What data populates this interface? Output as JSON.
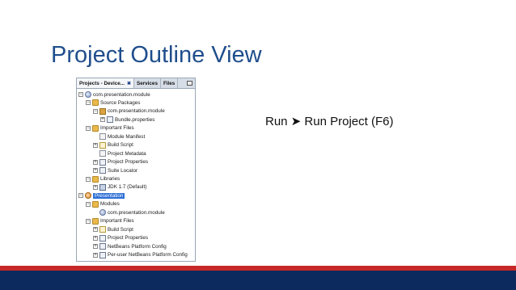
{
  "slide": {
    "title": "Project Outline View",
    "instruction": "Run ➤ Run Project (F6)"
  },
  "panel": {
    "tabs": [
      {
        "label": "Projects - Device..."
      },
      {
        "label": "Services"
      },
      {
        "label": "Files"
      }
    ],
    "tree": [
      {
        "label": "com.presentation.module",
        "icon": "module-icon",
        "toggle": "-",
        "selected": false
      },
      {
        "label": "Source Packages",
        "icon": "folder-icon",
        "toggle": "-",
        "selected": false
      },
      {
        "label": "com.presentation.module",
        "icon": "package-icon",
        "toggle": "-",
        "selected": false
      },
      {
        "label": "Bundle.properties",
        "icon": "properties-file-icon",
        "toggle": "+",
        "selected": false
      },
      {
        "label": "Important Files",
        "icon": "folder-icon",
        "toggle": "-",
        "selected": false
      },
      {
        "label": "Module Manifest",
        "icon": "file-icon",
        "toggle": "",
        "selected": false
      },
      {
        "label": "Build Script",
        "icon": "xml-file-icon",
        "toggle": "+",
        "selected": false
      },
      {
        "label": "Project Metadata",
        "icon": "file-icon",
        "toggle": "",
        "selected": false
      },
      {
        "label": "Project Properties",
        "icon": "properties-file-icon",
        "toggle": "+",
        "selected": false
      },
      {
        "label": "Suite Locator",
        "icon": "properties-file-icon",
        "toggle": "+",
        "selected": false
      },
      {
        "label": "Libraries",
        "icon": "folder-icon",
        "toggle": "-",
        "selected": false
      },
      {
        "label": "JDK 1.7 (Default)",
        "icon": "jdk-icon",
        "toggle": "+",
        "selected": false
      },
      {
        "label": "Presentation",
        "icon": "suite-icon",
        "toggle": "-",
        "selected": true
      },
      {
        "label": "Modules",
        "icon": "folder-icon",
        "toggle": "-",
        "selected": false
      },
      {
        "label": "com.presentation.module",
        "icon": "module-icon",
        "toggle": "",
        "selected": false
      },
      {
        "label": "Important Files",
        "icon": "folder-icon",
        "toggle": "-",
        "selected": false
      },
      {
        "label": "Build Script",
        "icon": "xml-file-icon",
        "toggle": "+",
        "selected": false
      },
      {
        "label": "Project Properties",
        "icon": "properties-file-icon",
        "toggle": "+",
        "selected": false
      },
      {
        "label": "NetBeans Platform Config",
        "icon": "properties-file-icon",
        "toggle": "+",
        "selected": false
      },
      {
        "label": "Per-user NetBeans Platform Config",
        "icon": "properties-file-icon",
        "toggle": "+",
        "selected": false
      }
    ]
  },
  "colors": {
    "title": "#1f4e8c",
    "footer_red": "#c62828",
    "footer_blue": "#0c2a5e",
    "selection": "#2e6fd6"
  }
}
